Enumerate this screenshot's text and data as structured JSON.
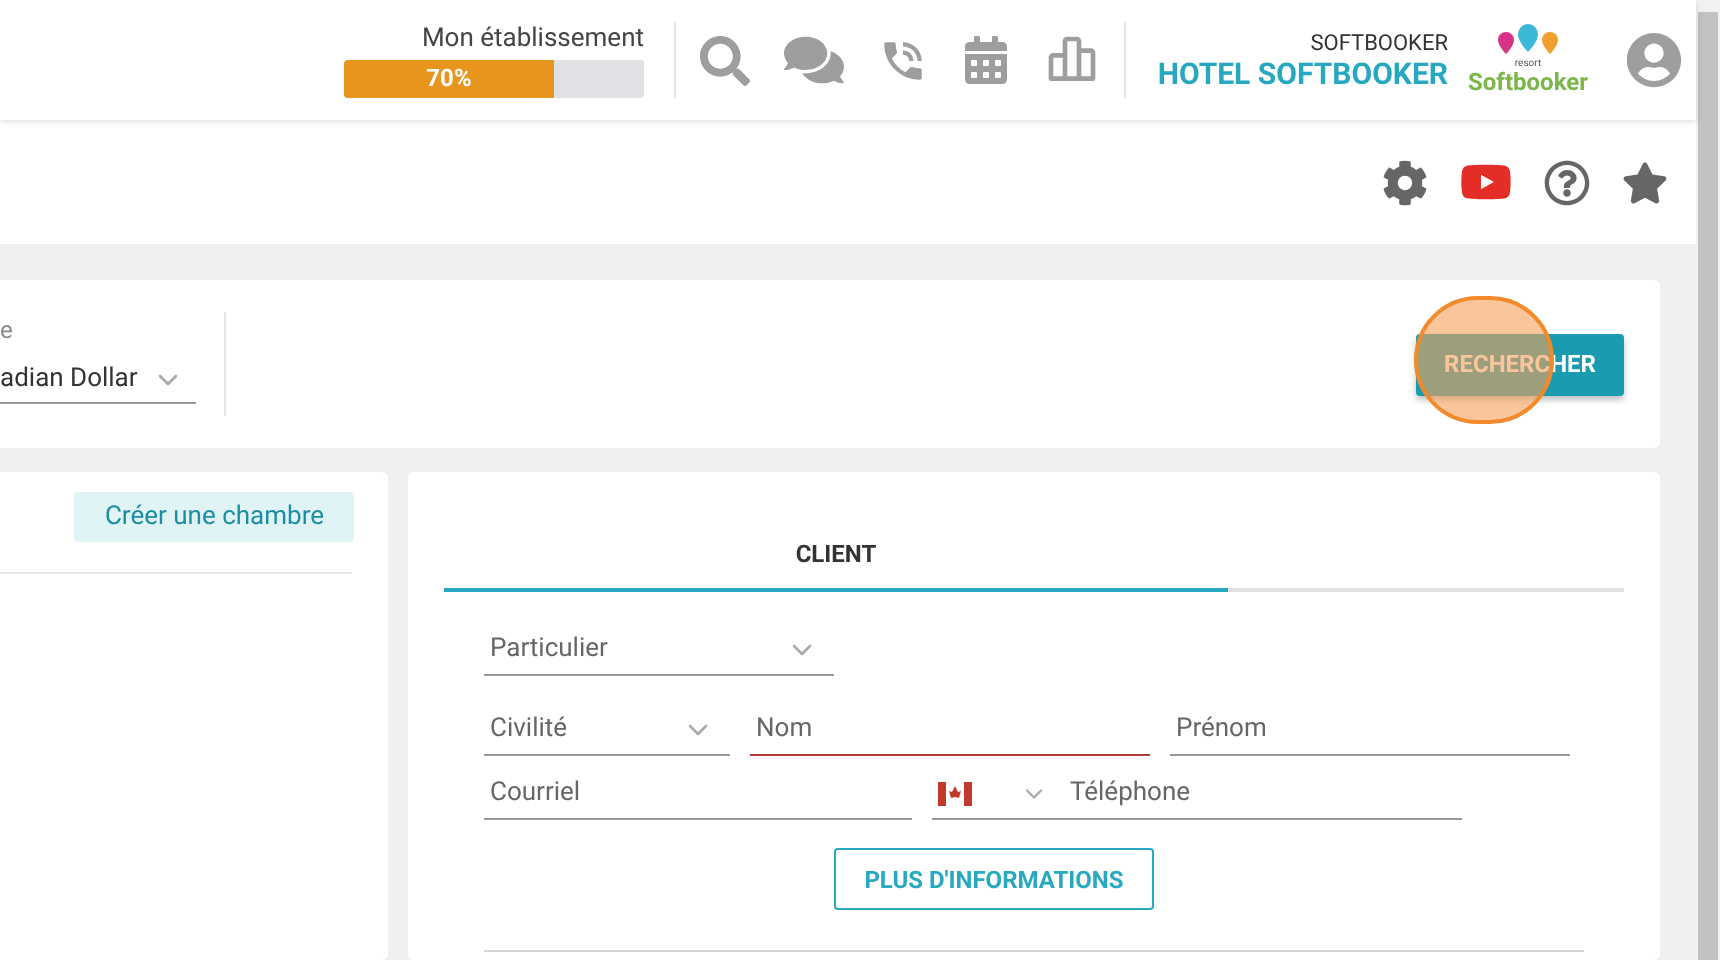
{
  "header": {
    "progress": {
      "label": "Mon établissement",
      "reading": "70%",
      "level": 0.7
    },
    "company": "SOFTBOOKER",
    "hotel": "HOTEL SOFTBOOKER",
    "logo": {
      "tag": "resort",
      "name": "Softbooker"
    }
  },
  "search_bar": {
    "currency": {
      "label": "e",
      "value": "adian Dollar"
    },
    "button": "RECHERCHER",
    "click_marker": true
  },
  "rooms_panel": {
    "button": "Créer une chambre"
  },
  "client_panel": {
    "tabs": [
      {
        "label": "CLIENT",
        "selected": true
      }
    ],
    "field_rows": [
      [
        {
          "kind": "select",
          "placeholder": "Particulier",
          "error": false
        }
      ],
      [
        {
          "kind": "select",
          "placeholder": "Civilité",
          "error": false
        },
        {
          "kind": "text",
          "placeholder": "Nom",
          "error": true
        },
        {
          "kind": "text",
          "placeholder": "Prénom",
          "error": false
        }
      ],
      [
        {
          "kind": "text",
          "placeholder": "Courriel",
          "error": false
        },
        {
          "kind": "phone",
          "placeholder": "Téléphone",
          "error": false
        }
      ]
    ],
    "more_button": "PLUS D'INFORMATIONS"
  }
}
